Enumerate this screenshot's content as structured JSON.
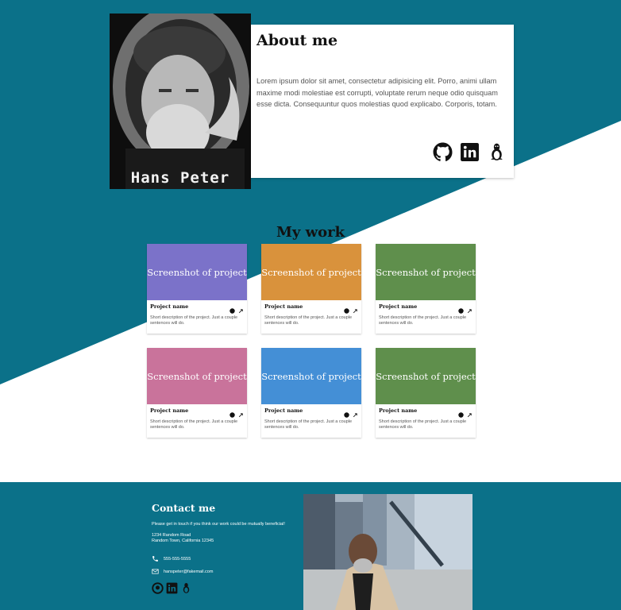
{
  "colors": {
    "teal": "#0b7189",
    "white": "#ffffff"
  },
  "hero": {
    "portrait_name": "Hans Peter",
    "about_title": "About me",
    "about_text": "Lorem ipsum dolor sit amet, consectetur adipisicing elit. Porro, animi ullam maxime modi molestiae est corrupti, voluptate rerum neque odio quisquam esse dicta. Consequuntur quos molestias quod explicabo. Corporis, totam.",
    "icons": [
      "github-icon",
      "linkedin-icon",
      "linux-icon"
    ]
  },
  "work": {
    "title": "My work",
    "projects": [
      {
        "screenshot_label": "Screenshot of project",
        "name": "Project name",
        "description": "Short description of the project. Just a couple sentences will do.",
        "color": "#7b72c9"
      },
      {
        "screenshot_label": "Screenshot of project",
        "name": "Project name",
        "description": "Short description of the project. Just a couple sentences will do.",
        "color": "#d9923c"
      },
      {
        "screenshot_label": "Screenshot of project",
        "name": "Project name",
        "description": "Short description of the project. Just a couple sentences will do.",
        "color": "#5f8f4c"
      },
      {
        "screenshot_label": "Screenshot of project",
        "name": "Project name",
        "description": "Short description of the project. Just a couple sentences will do.",
        "color": "#c9739b"
      },
      {
        "screenshot_label": "Screenshot of project",
        "name": "Project name",
        "description": "Short description of the project. Just a couple sentences will do.",
        "color": "#448fd6"
      },
      {
        "screenshot_label": "Screenshot of project",
        "name": "Project name",
        "description": "Short description of the project. Just a couple sentences will do.",
        "color": "#5f8f4c"
      }
    ]
  },
  "contact": {
    "title": "Contact me",
    "intro": "Please get in touch if you think our work could be mutually beneficial!",
    "address_line1": "1234 Random Road",
    "address_line2": "Random Town, California 12345",
    "phone": "555-555-5555",
    "email": "hanspeter@fakemail.com",
    "icons": [
      "github-icon",
      "linkedin-icon",
      "linux-icon"
    ]
  }
}
